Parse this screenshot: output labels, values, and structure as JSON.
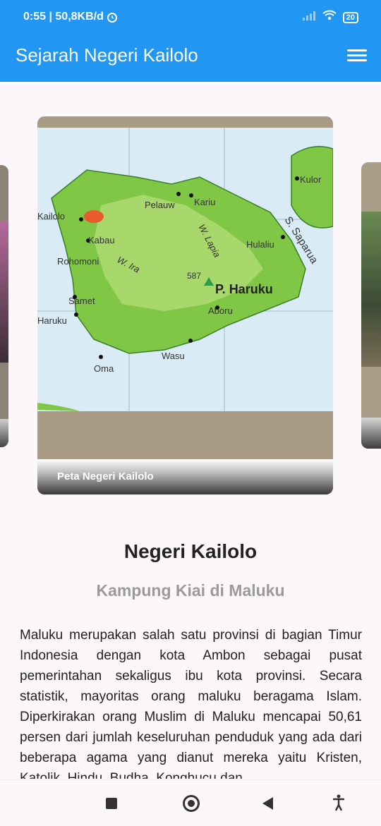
{
  "status_bar": {
    "time": "0:55 | 50,8KB/d",
    "battery": "20",
    "icons": [
      "alarm-icon",
      "signal-icon",
      "wifi-icon",
      "battery-icon"
    ]
  },
  "app_bar": {
    "title": "Sejarah Negeri Kailolo",
    "menu_icon": "hamburger-menu-icon"
  },
  "carousel": {
    "current": {
      "caption": "Peta Negeri Kailolo",
      "map_labels": {
        "kailolo": "Kailolo",
        "kabau": "Kabau",
        "rohomoni": "Rohomoni",
        "samet": "Samet",
        "haruku": "Haruku",
        "oma": "Oma",
        "wasu": "Wasu",
        "aboru": "Aboru",
        "p_haruku": "P. Haruku",
        "elev": "587",
        "w_ira": "W. Ira",
        "w_lapia": "W. Lapia",
        "hulaliu": "Hulaliu",
        "pelauw": "Pelauw",
        "kariu": "Kariu",
        "kulor": "Kulor",
        "s_saparua": "S. Saparua"
      }
    }
  },
  "article": {
    "title": "Negeri Kailolo",
    "subtitle": "Kampung Kiai di Maluku",
    "body": "Maluku merupakan salah satu provinsi di bagian Timur Indonesia dengan kota Ambon sebagai pusat pemerintahan sekaligus ibu kota provinsi. Secara statistik, mayoritas orang maluku beragama Islam. Diperkirakan orang Muslim di Maluku mencapai 50,61 persen dari jumlah keseluruhan penduduk yang ada dari beberapa agama yang dianut mereka yaitu Kristen, Katolik, Hindu, Budha, Konghucu dan"
  },
  "nav_bar": {
    "icons": [
      "recents-square-icon",
      "home-circle-icon",
      "back-triangle-icon",
      "accessibility-icon"
    ]
  }
}
